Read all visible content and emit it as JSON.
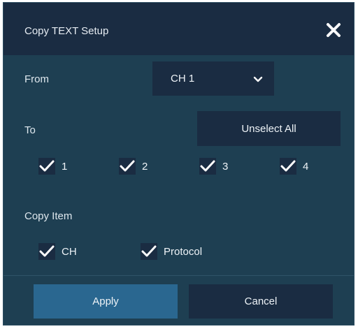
{
  "dialog": {
    "title": "Copy TEXT Setup",
    "close_icon": "close-icon"
  },
  "from": {
    "label": "From",
    "selected": "CH 1",
    "chevron_icon": "chevron-down-icon"
  },
  "to": {
    "label": "To",
    "unselect_label": "Unselect All",
    "channels": [
      {
        "label": "1",
        "checked": true
      },
      {
        "label": "2",
        "checked": true
      },
      {
        "label": "3",
        "checked": true
      },
      {
        "label": "4",
        "checked": true
      }
    ]
  },
  "copy_item": {
    "label": "Copy Item",
    "items": [
      {
        "label": "CH",
        "checked": true
      },
      {
        "label": "Protocol",
        "checked": true
      }
    ]
  },
  "footer": {
    "apply_label": "Apply",
    "cancel_label": "Cancel"
  },
  "colors": {
    "body_bg": "#1e3f52",
    "header_bg": "#1a2c42",
    "control_bg": "#1a2c42",
    "accent": "#2a6790",
    "check": "#ffffff",
    "text": "#eef3f7"
  }
}
